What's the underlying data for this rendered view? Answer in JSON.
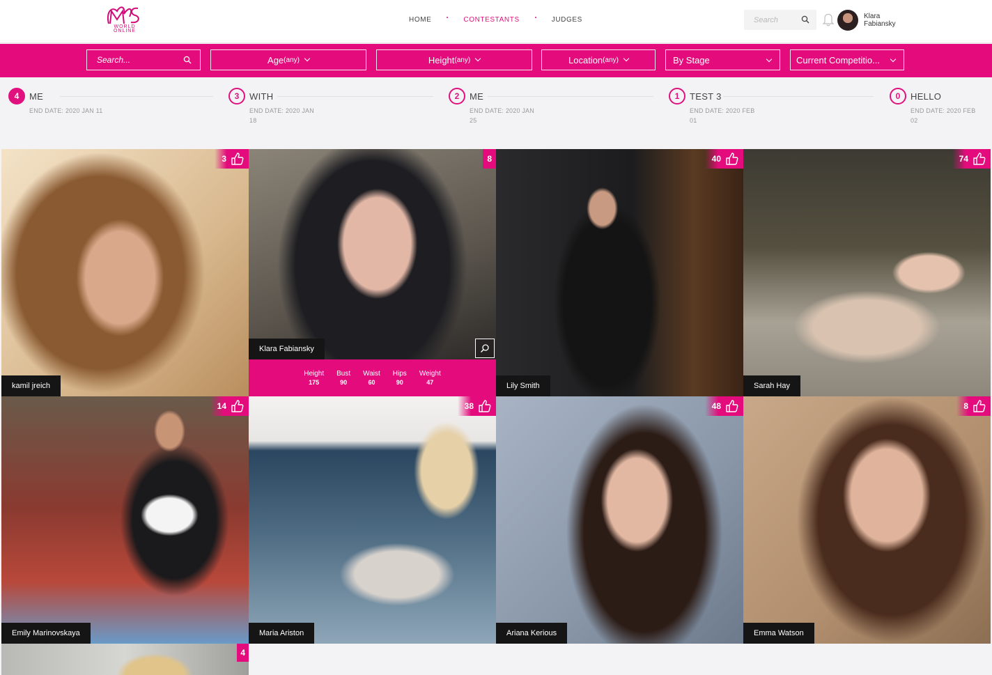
{
  "colors": {
    "accent": "#e40c7c",
    "name_tag": "#151515",
    "header_bg": "#ffffff",
    "page_bg": "#f3f3f5"
  },
  "logo": {
    "mark": "MS",
    "subtitle": "WORLD ONLINE"
  },
  "nav": {
    "items": [
      "HOME",
      "CONTESTANTS",
      "JUDGES"
    ],
    "active": "CONTESTANTS"
  },
  "top_search": {
    "placeholder": "Search",
    "icon": "search-icon"
  },
  "notifications": {
    "icon": "bell-icon"
  },
  "user": {
    "name": "Klara Fabiansky"
  },
  "filters": {
    "search_placeholder": "Search...",
    "age": {
      "label": "Age",
      "value": "(any)"
    },
    "height": {
      "label": "Height",
      "value": "(any)"
    },
    "location": {
      "label": "Location",
      "value": "(any)"
    },
    "stage": {
      "label": "By Stage"
    },
    "competition": {
      "label": "Current Competitio..."
    }
  },
  "stages": [
    {
      "number": "4",
      "title": "ME",
      "date": "END DATE: 2020 JAN 11",
      "current": true
    },
    {
      "number": "3",
      "title": "WITH",
      "date": "END DATE: 2020 JAN 18",
      "current": false
    },
    {
      "number": "2",
      "title": "ME",
      "date": "END DATE: 2020 JAN 25",
      "current": false
    },
    {
      "number": "1",
      "title": "TEST 3",
      "date": "END DATE: 2020 FEB 01",
      "current": false
    },
    {
      "number": "0",
      "title": "HELLO",
      "date": "END DATE: 2020 FEB 02",
      "current": false
    }
  ],
  "contestants": [
    {
      "name": "kamil jreich",
      "votes": "3",
      "vote_icon": "thumbs-up-icon"
    },
    {
      "name": "Klara Fabiansky",
      "votes": "8",
      "hover": true,
      "zoom_icon": "zoom-icon",
      "stats": [
        {
          "label": "Height",
          "value": "175"
        },
        {
          "label": "Bust",
          "value": "90"
        },
        {
          "label": "Waist",
          "value": "60"
        },
        {
          "label": "Hips",
          "value": "90"
        },
        {
          "label": "Weight",
          "value": "47"
        }
      ]
    },
    {
      "name": "Lily Smith",
      "votes": "40",
      "vote_icon": "thumbs-up-icon"
    },
    {
      "name": "Sarah Hay",
      "votes": "74",
      "vote_icon": "thumbs-up-icon"
    },
    {
      "name": "Emily Marinovskaya",
      "votes": "14",
      "vote_icon": "thumbs-up-icon"
    },
    {
      "name": "Maria Ariston",
      "votes": "38",
      "vote_icon": "thumbs-up-icon"
    },
    {
      "name": "Ariana Kerious",
      "votes": "48",
      "vote_icon": "thumbs-up-icon"
    },
    {
      "name": "Emma Watson",
      "votes": "8",
      "vote_icon": "thumbs-up-icon"
    },
    {
      "votes": "4"
    }
  ]
}
